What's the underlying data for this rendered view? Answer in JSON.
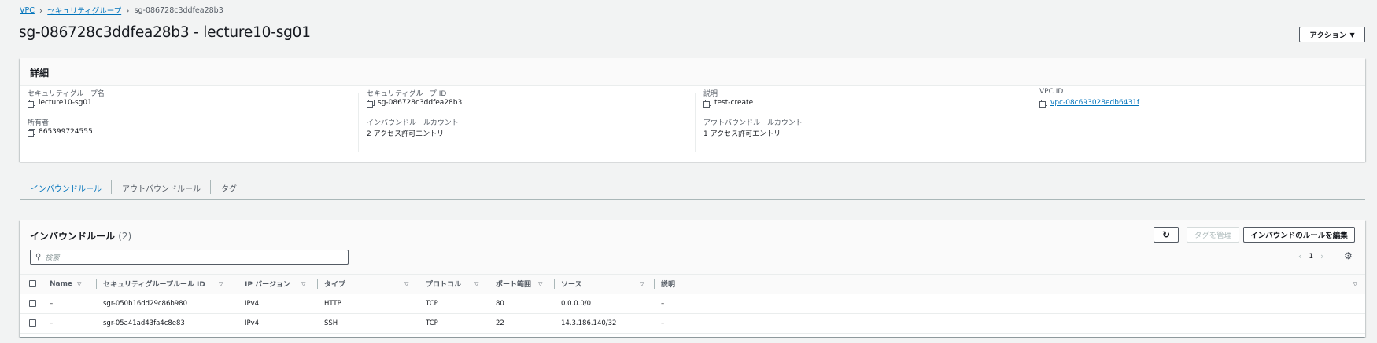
{
  "breadcrumb": {
    "items": [
      "VPC",
      "セキュリティグループ"
    ],
    "current": "sg-086728c3ddfea28b3"
  },
  "page": {
    "title": "sg-086728c3ddfea28b3 - lecture10-sg01",
    "action_label": "アクション"
  },
  "details": {
    "header": "詳細",
    "fields": [
      {
        "label": "セキュリティグループ名",
        "value": "lecture10-sg01"
      },
      {
        "label": "セキュリティグループ ID",
        "value": "sg-086728c3ddfea28b3"
      },
      {
        "label": "説明",
        "value": "test-create"
      },
      {
        "label": "VPC ID",
        "value": "vpc-08c693028edb6431f"
      },
      {
        "label": "所有者",
        "value": "865399724555"
      },
      {
        "label": "インバウンドルールカウント",
        "value": "2 アクセス許可エントリ"
      },
      {
        "label": "アウトバウンドルールカウント",
        "value": "1 アクセス許可エントリ"
      }
    ]
  },
  "tabs": [
    "インバウンドルール",
    "アウトバウンドルール",
    "タグ"
  ],
  "rules": {
    "title": "インバウンドルール",
    "count": "(2)",
    "manage_tags_label": "タグを管理",
    "edit_label": "インバウンドのルールを編集",
    "search_placeholder": "検索",
    "page": "1",
    "columns": [
      "Name",
      "セキュリティグループルール ID",
      "IP バージョン",
      "タイプ",
      "プロトコル",
      "ポート範囲",
      "ソース",
      "説明"
    ],
    "rows": [
      [
        "–",
        "sgr-050b16dd29c86b980",
        "IPv4",
        "HTTP",
        "TCP",
        "80",
        "0.0.0.0/0",
        "–"
      ],
      [
        "–",
        "sgr-05a41ad43fa4c8e83",
        "IPv4",
        "SSH",
        "TCP",
        "22",
        "14.3.186.140/32",
        "–"
      ]
    ]
  },
  "colors": {
    "link": "#0073bb",
    "background": "#f2f3f3"
  }
}
